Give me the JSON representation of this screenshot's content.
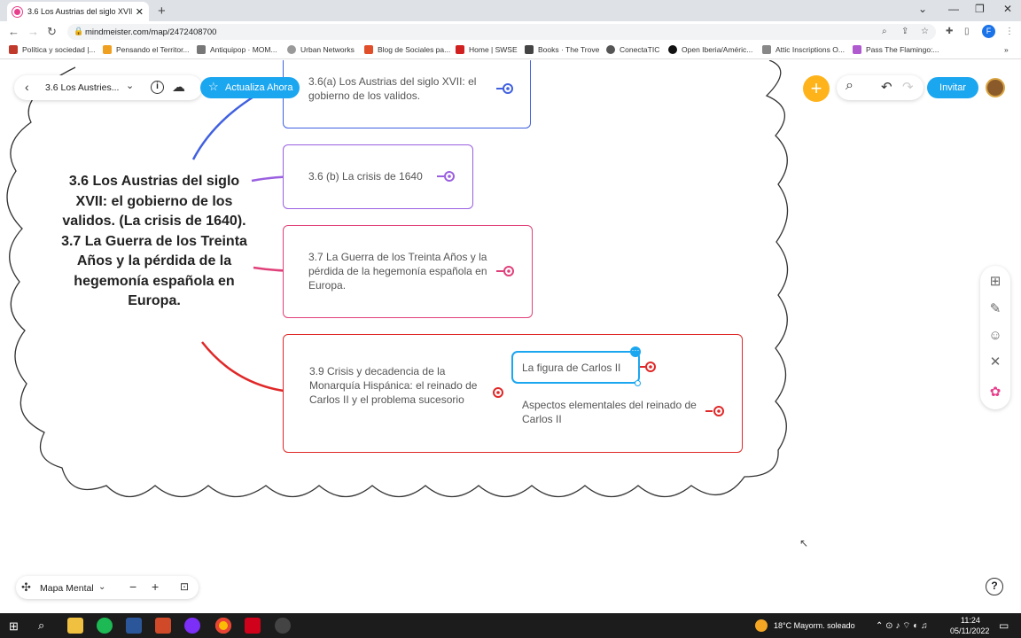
{
  "browser": {
    "tab_title": "3.6 Los Austrias del siglo XVII: e",
    "tab_close": "✕",
    "new_tab": "+",
    "url": "mindmeister.com/map/2472408700",
    "profile_initial": "F",
    "bookmarks": [
      "Política y sociedad |...",
      "Pensando el Territor...",
      "Antiquipop · MOM...",
      "Urban Networks",
      "Blog de Sociales pa...",
      "Home | SWSE",
      "Books · The Trove",
      "ConectaTIC",
      "Open Iberia/Améric...",
      "Attic Inscriptions O...",
      "Pass The Flamingo:..."
    ],
    "bookmarks_more": "»"
  },
  "toolbar": {
    "back": "‹",
    "map_title": "3.6 Los Austries...",
    "dropdown": "⌄",
    "info_icon": "i",
    "cloud_icon": "☁",
    "upgrade_label": "Actualiza Ahora",
    "add": "+",
    "search_icon": "⌕",
    "undo_icon": "↶",
    "redo_icon": "↷",
    "invite_label": "Invitar"
  },
  "map": {
    "central": "3.6 Los Austrias del siglo XVII: el gobierno de los validos. (La crisis de 1640). 3.7 La Guerra de los Treinta Años y la pérdida de la hegemonía española en Europa.",
    "topics": [
      {
        "text": "3.6(a) Los Austrias del siglo XVII: el gobierno de los validos.",
        "color": "#4060e0"
      },
      {
        "text": "3.6 (b) La crisis de 1640",
        "color": "#9a5fe0"
      },
      {
        "text": "3.7 La Guerra de los Treinta Años y la pérdida de la hegemonía española en Europa.",
        "color": "#e0407a"
      },
      {
        "text": "3.9 Crisis y decadencia de la Monarquía Hispánica: el reinado de Carlos II y el problema sucesorio",
        "color": "#e02828"
      }
    ],
    "subtopics": [
      {
        "text": "La figura de Carlos II",
        "selected": true
      },
      {
        "text": "Aspectos elementales del reinado de Carlos II",
        "selected": false
      }
    ],
    "selection_color": "#1ba6f0"
  },
  "side_tools": [
    "layout-icon",
    "paint-icon",
    "emoji-icon",
    "connect-icon",
    "apps-icon"
  ],
  "bottom": {
    "view_label": "Mapa Mental",
    "zoom_out": "−",
    "zoom_in": "+",
    "fit": "⊡",
    "help": "?"
  },
  "taskbar": {
    "weather": "18°C  Mayorm. soleado",
    "time": "11:24",
    "date": "05/11/2022"
  }
}
